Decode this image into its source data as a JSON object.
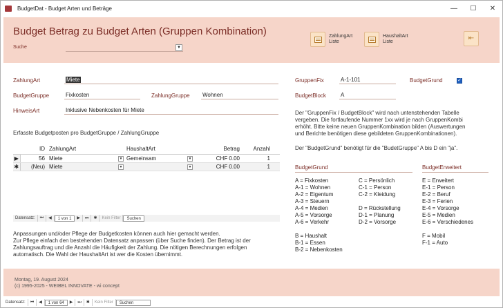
{
  "window": {
    "title": "BudgetDat - Budget Arten und Beträge",
    "minimize": "—",
    "maximize": "☐",
    "close": "✕"
  },
  "header": {
    "title": "Budget Betrag zu Budget Arten (Gruppen Kombination)",
    "suche_label": "Suche",
    "suche_value": "",
    "btn_zahlungart": "ZahlungArt Liste",
    "btn_haushaltart": "HaushaltArt Liste"
  },
  "form": {
    "zahlungart_label": "ZahlungArt",
    "zahlungart_value": "Miete",
    "budgetgruppe_label": "BudgetGruppe",
    "budgetgruppe_value": "Fixkosten",
    "zahlungsgruppe_label": "ZahlungGruppe",
    "zahlungsgruppe_value": "Wohnen",
    "hinweisart_label": "HinweisArt",
    "hinweisart_value": "Inklusive Nebenkosten für Miete",
    "gruppenfix_label": "GruppenFix",
    "gruppenfix_value": "A-1-101",
    "budgetgrund_label": "BudgetGrund",
    "budgetblock_label": "BudgetBlock",
    "budgetblock_value": "A"
  },
  "subform": {
    "caption": "Erfasste Budgetposten pro BudgetGruppe / ZahlungGruppe",
    "columns": [
      "ID",
      "ZahlungArt",
      "HaushaltArt",
      "Betrag",
      "Anzahl"
    ],
    "rows": [
      {
        "id": "56",
        "zahlungart": "Miete",
        "haushaltart": "Gemeinsam",
        "betrag": "CHF 0.00",
        "anzahl": "1"
      },
      {
        "id": "(Neu)",
        "zahlungart": "Miete",
        "haushaltart": "",
        "betrag": "CHF 0.00",
        "anzahl": "1"
      }
    ],
    "nav": {
      "label": "Datensatz:",
      "pos": "1 von 1",
      "filter": "Kein Filter",
      "search": "Suchen"
    }
  },
  "notes": {
    "left": [
      "Anpassungen und/oder Pflege der Budgetkosten können auch hier gemacht werden.",
      "Zur Pflege einfach den bestehenden Datensatz anpassen (über Suche finden). Der Betrag ist der",
      "Zahlungsauftrag und die Anzahl die Häufigkeit der Zahlung. Die nötigen Berechnungen erfolgen",
      "automatisch. Die Wahl der HaushaltArt ist wer die Kosten übernimmt."
    ],
    "right1": [
      "Der \"GruppenFix / BudgetBlock\" wird nach untenstehenden Tabelle",
      "vergeben. Die fortlaufende Nummer 1xx wird je nach GruppenKombi",
      "erhöht. Bitte keine neuen GruppenKombination bilden (Auswertungen",
      "und Berichte benötigen diese gebildeten GruppenKombinationen)."
    ],
    "right2": "Der \"BudgetGrund\" benötigt für die \"BudetGruppe\" A bis D ein \"ja\"."
  },
  "budgetgrund": {
    "title": "BudgetGrund",
    "col1": [
      "A = Fixkosten",
      "A-1 = Wohnen",
      "A-2 = Eigentum",
      "A-3 = Steuern",
      "A-4 = Medien",
      "A-5 = Vorsorge",
      "A-6 = Verkehr"
    ],
    "col2": [
      "C = Persönlich",
      "C-1 = Person",
      "C-2 = Kleidung",
      "",
      "D = Rückstellung",
      "D-1 = Planung",
      "D-2 = Vorsorge"
    ],
    "col3": [
      "B = Haushalt",
      "B-1 = Essen",
      "B-2 = Nebenkosten"
    ]
  },
  "budgeterweitert": {
    "title": "BudgetErweitert",
    "col1": [
      "E = Erweitert",
      "E-1 = Person",
      "E-2 = Beruf",
      "E-3 = Ferien",
      "E-4 = Vorsorge",
      "E-5 = Medien",
      "E-6 = Verschiedenes"
    ],
    "col2": [
      "F = Mobil",
      "F-1 = Auto"
    ]
  },
  "footer": {
    "date": "Montag, 19. August 2024",
    "copyright": "(c) 1995-2025 - WEIBEL INNOVATE - wi concept"
  },
  "mainnav": {
    "label": "Datensatz:",
    "pos": "1 von 64",
    "filter": "Kein Filter",
    "search": "Suchen"
  }
}
